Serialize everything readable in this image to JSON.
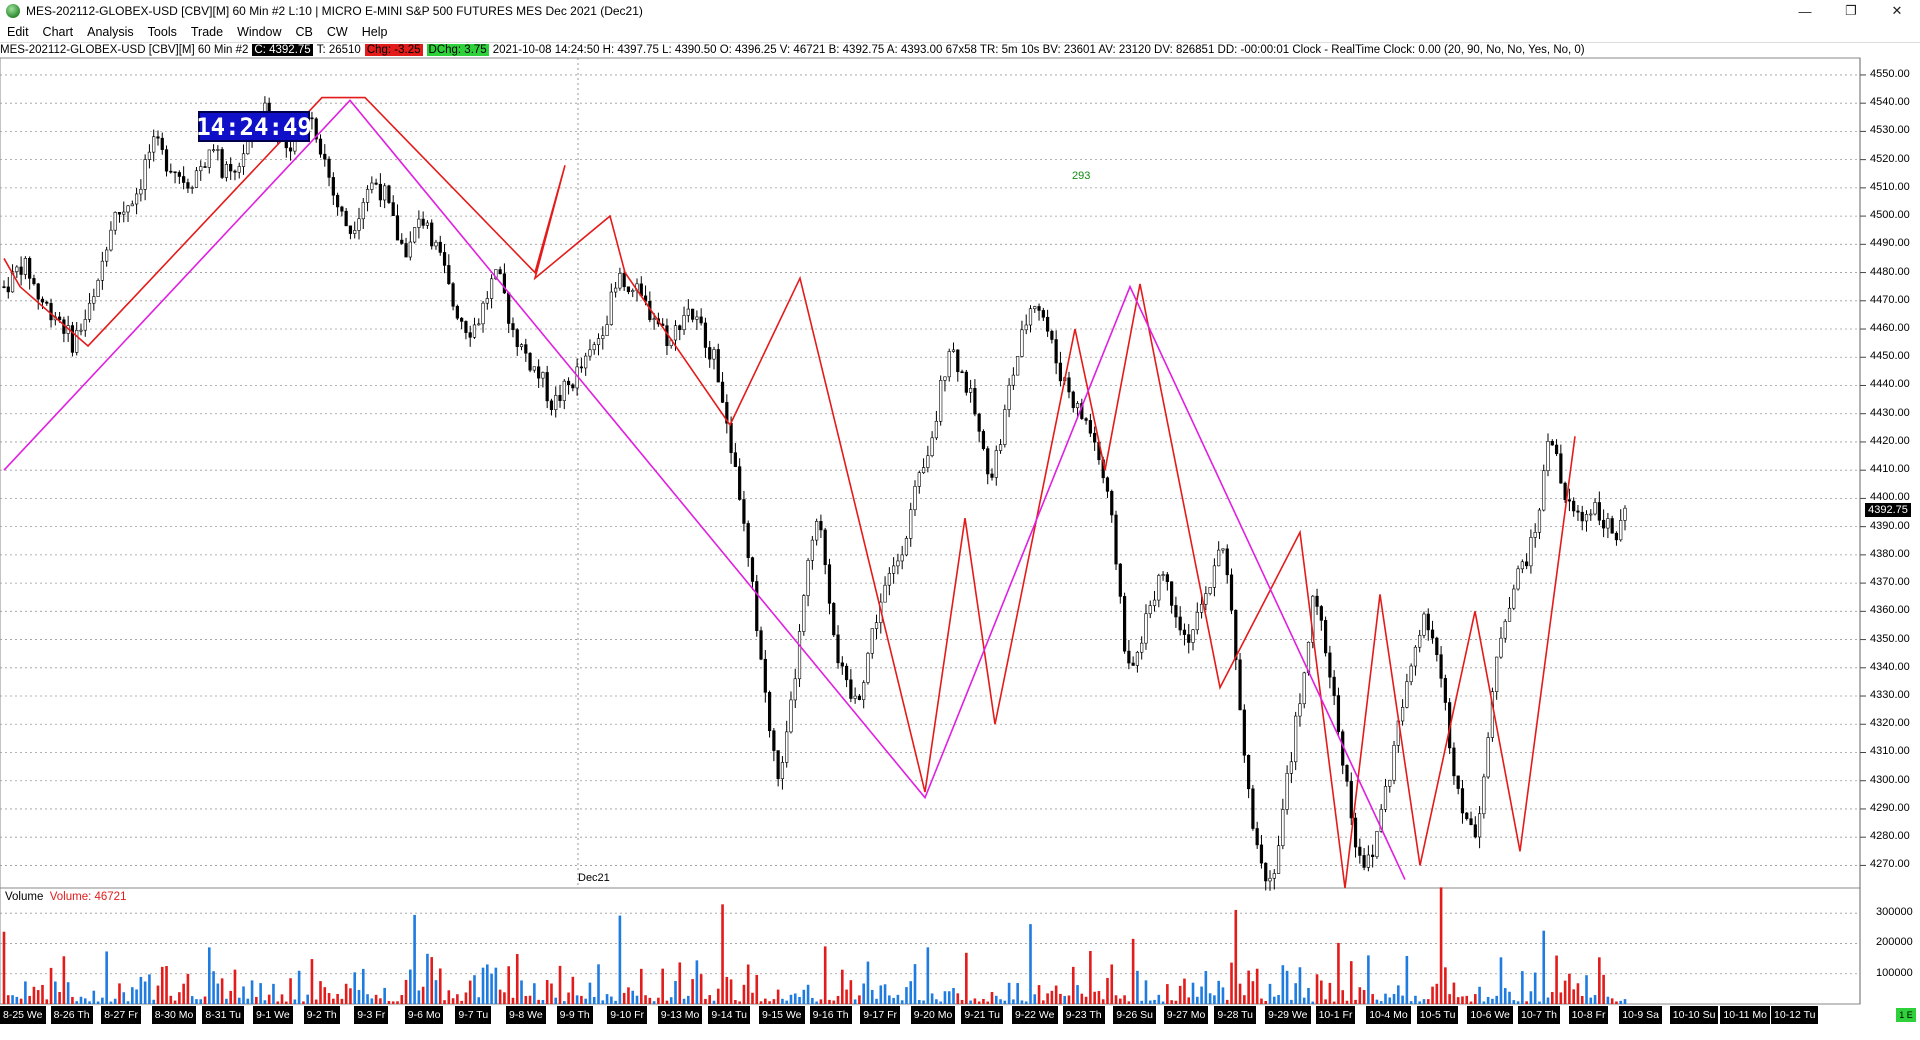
{
  "window": {
    "title": "MES-202112-GLOBEX-USD [CBV][M]  60 Min   #2 L:10 | MICRO E-MINI S&P 500 FUTURES MES Dec 2021 (Dec21)",
    "minimize": "—",
    "restore": "❐",
    "close": "✕"
  },
  "menu": [
    "Edit",
    "Chart",
    "Analysis",
    "Tools",
    "Trade",
    "Window",
    "CB",
    "CW",
    "Help"
  ],
  "info": {
    "symbol": "MES-202112-GLOBEX-USD [CBV][M]  60 Min  #2",
    "close": "C: 4392.75",
    "ticks": "T: 26510",
    "chg": "Chg: -3.25",
    "dchg": "DChg: 3.75",
    "rest": "2021-10-08 14:24:50 H: 4397.75 L: 4390.50 O: 4396.25 V: 46721 B: 4392.75 A: 4393.00 67x58 TR: 5m 10s BV: 23601 AV: 23120 DV: 826851 DD: -00:00:01 Clock - RealTime  Clock: 0.00   (20, 90, No, No, Yes, No, 0)"
  },
  "clock": "14:24:49",
  "last_price": "4392.75",
  "bar_count": "293",
  "contract_marker": "Dec21",
  "volume": {
    "label": "Volume",
    "value": "Volume: 46721"
  },
  "price_axis": [
    "4550.00",
    "4540.00",
    "4530.00",
    "4520.00",
    "4510.00",
    "4500.00",
    "4490.00",
    "4480.00",
    "4470.00",
    "4460.00",
    "4450.00",
    "4440.00",
    "4430.00",
    "4420.00",
    "4410.00",
    "4400.00",
    "4390.00",
    "4380.00",
    "4370.00",
    "4360.00",
    "4350.00",
    "4340.00",
    "4330.00",
    "4320.00",
    "4310.00",
    "4300.00",
    "4290.00",
    "4280.00",
    "4270.00"
  ],
  "volume_axis": [
    "300000",
    "200000",
    "100000"
  ],
  "date_labels": [
    "8-25 We",
    "8-26 Th",
    "8-27 Fr",
    "8-30 Mo",
    "8-31 Tu",
    "9-1 We",
    "9-2 Th",
    "9-3 Fr",
    "9-6 Mo",
    "9-7 Tu",
    "9-8 We",
    "9-9 Th",
    "9-10 Fr",
    "9-13 Mo",
    "9-14 Tu",
    "9-15 We",
    "9-16 Th",
    "9-17 Fr",
    "9-20 Mo",
    "9-21 Tu",
    "9-22 We",
    "9-23 Th",
    "9-26 Su",
    "9-27 Mo",
    "9-28 Tu",
    "9-29 We",
    "10-1 Fr",
    "10-4 Mo",
    "10-5 Tu",
    "10-6 We",
    "10-7 Th",
    "10-8 Fr",
    "10-9 Sa",
    "10-10 Su",
    "10-11 Mo",
    "10-12 Tu"
  ],
  "corner": "1 E",
  "chart_data": {
    "type": "candlestick",
    "ylim": [
      4262,
      4556
    ],
    "price_path": [
      4475,
      4478,
      4483,
      4480,
      4472,
      4468,
      4466,
      4462,
      4455,
      4460,
      4466,
      4472,
      4490,
      4500,
      4502,
      4506,
      4510,
      4522,
      4525,
      4520,
      4518,
      4514,
      4512,
      4517,
      4520,
      4522,
      4516,
      4512,
      4520,
      4528,
      4533,
      4538,
      4535,
      4525,
      4520,
      4533,
      4538,
      4530,
      4520,
      4508,
      4500,
      4495,
      4502,
      4510,
      4512,
      4508,
      4498,
      4490,
      4488,
      4498,
      4500,
      4490,
      4482,
      4470,
      4465,
      4460,
      4462,
      4470,
      4478,
      4475,
      4462,
      4455,
      4450,
      4445,
      4440,
      4433,
      4437,
      4440,
      4445,
      4448,
      4454,
      4462,
      4470,
      4478,
      4476,
      4472,
      4468,
      4465,
      4460,
      4455,
      4463,
      4468,
      4462,
      4458,
      4450,
      4440,
      4420,
      4405,
      4380,
      4360,
      4335,
      4310,
      4300,
      4320,
      4345,
      4370,
      4390,
      4385,
      4360,
      4340,
      4330,
      4328,
      4340,
      4355,
      4365,
      4372,
      4380,
      4390,
      4402,
      4410,
      4420,
      4440,
      4455,
      4448,
      4440,
      4430,
      4415,
      4410,
      4420,
      4438,
      4450,
      4462,
      4472,
      4466,
      4455,
      4445,
      4440,
      4432,
      4428,
      4422,
      4410,
      4395,
      4372,
      4340,
      4340,
      4355,
      4365,
      4375,
      4368,
      4360,
      4350,
      4355,
      4360,
      4372,
      4386,
      4370,
      4340,
      4310,
      4285,
      4270,
      4265,
      4278,
      4300,
      4320,
      4340,
      4362,
      4355,
      4340,
      4320,
      4300,
      4280,
      4272,
      4270,
      4290,
      4300,
      4318,
      4330,
      4345,
      4360,
      4355,
      4340,
      4320,
      4300,
      4290,
      4278,
      4296,
      4320,
      4348,
      4362,
      4370,
      4378,
      4383,
      4400,
      4420,
      4412,
      4398,
      4395,
      4393,
      4398,
      4396,
      4390,
      4385,
      4393
    ],
    "lines_red": [
      [
        4485,
        4475,
        4454,
        4466,
        4542,
        4542,
        4480,
        4518,
        4478,
        4500,
        4480,
        4426,
        4478,
        4296,
        4393,
        4320,
        4460,
        4410,
        4476,
        4333,
        4388,
        4262,
        4366,
        4270,
        4360,
        4275,
        4422
      ]
    ],
    "lines_magenta": [
      [
        4410,
        4541,
        4294,
        4475,
        4265
      ]
    ],
    "volume_max": 360000
  }
}
